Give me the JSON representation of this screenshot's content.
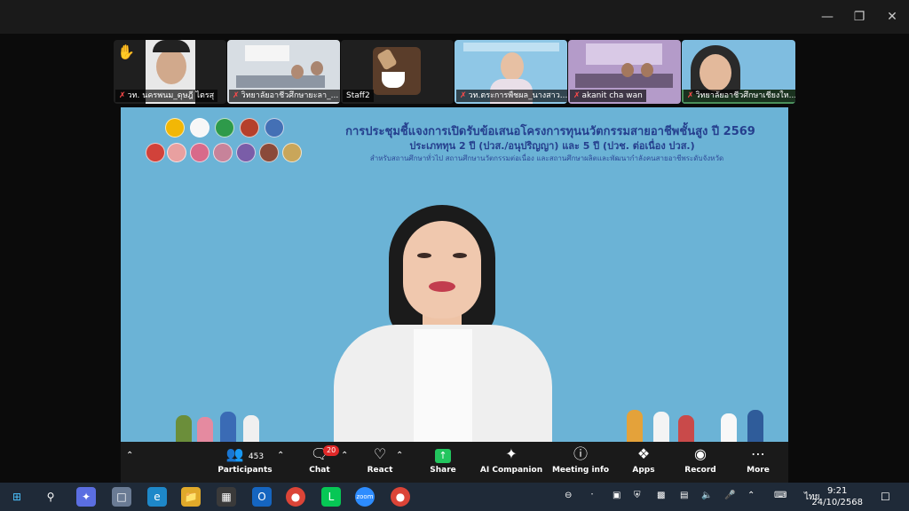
{
  "thumbnails": [
    {
      "label": "วท. นครพนม_ดุษฎี ไตรสุ",
      "muted": true,
      "hand": true
    },
    {
      "label": "วิทยาลัยอาชีวศึกษายะลา_...",
      "muted": true
    },
    {
      "label": "Staff2",
      "muted": false
    },
    {
      "label": "วท.ตระการพืชผล_นางสาว...",
      "muted": true
    },
    {
      "label": "akanit cha wan",
      "muted": true
    },
    {
      "label": "วิทยาลัยอาชีวศึกษาเชียงให...",
      "muted": true
    }
  ],
  "slide": {
    "title": "การประชุมชี้แจงการเปิดรับข้อเสนอโครงการทุนนวัตกรรมสายอาชีพชั้นสูง ปี 2569",
    "subtitle": "ประเภททุน 2 ปี (ปวส./อนุปริญญา) และ 5 ปี (ปวช. ต่อเนื่อง ปวส.)",
    "small": "สำหรับสถานศึกษาทั่วไป สถานศึกษานวัตกรรมต่อเนื่อง และสถานศึกษาผลิตและพัฒนากำลังคนสายอาชีพระดับจังหวัด"
  },
  "toolbar": {
    "participants_label": "Participants",
    "participants_count": "453",
    "chat_label": "Chat",
    "chat_badge": "20",
    "react_label": "React",
    "share_label": "Share",
    "ai_label": "AI Companion",
    "info_label": "Meeting info",
    "apps_label": "Apps",
    "record_label": "Record",
    "more_label": "More"
  },
  "taskbar": {
    "lang": "ไทย",
    "time": "9:21",
    "date": "24/10/2568"
  },
  "colors": {
    "slide_bg": "#6bb3d6",
    "share_green": "#22c55e",
    "badge_red": "#e02828"
  }
}
